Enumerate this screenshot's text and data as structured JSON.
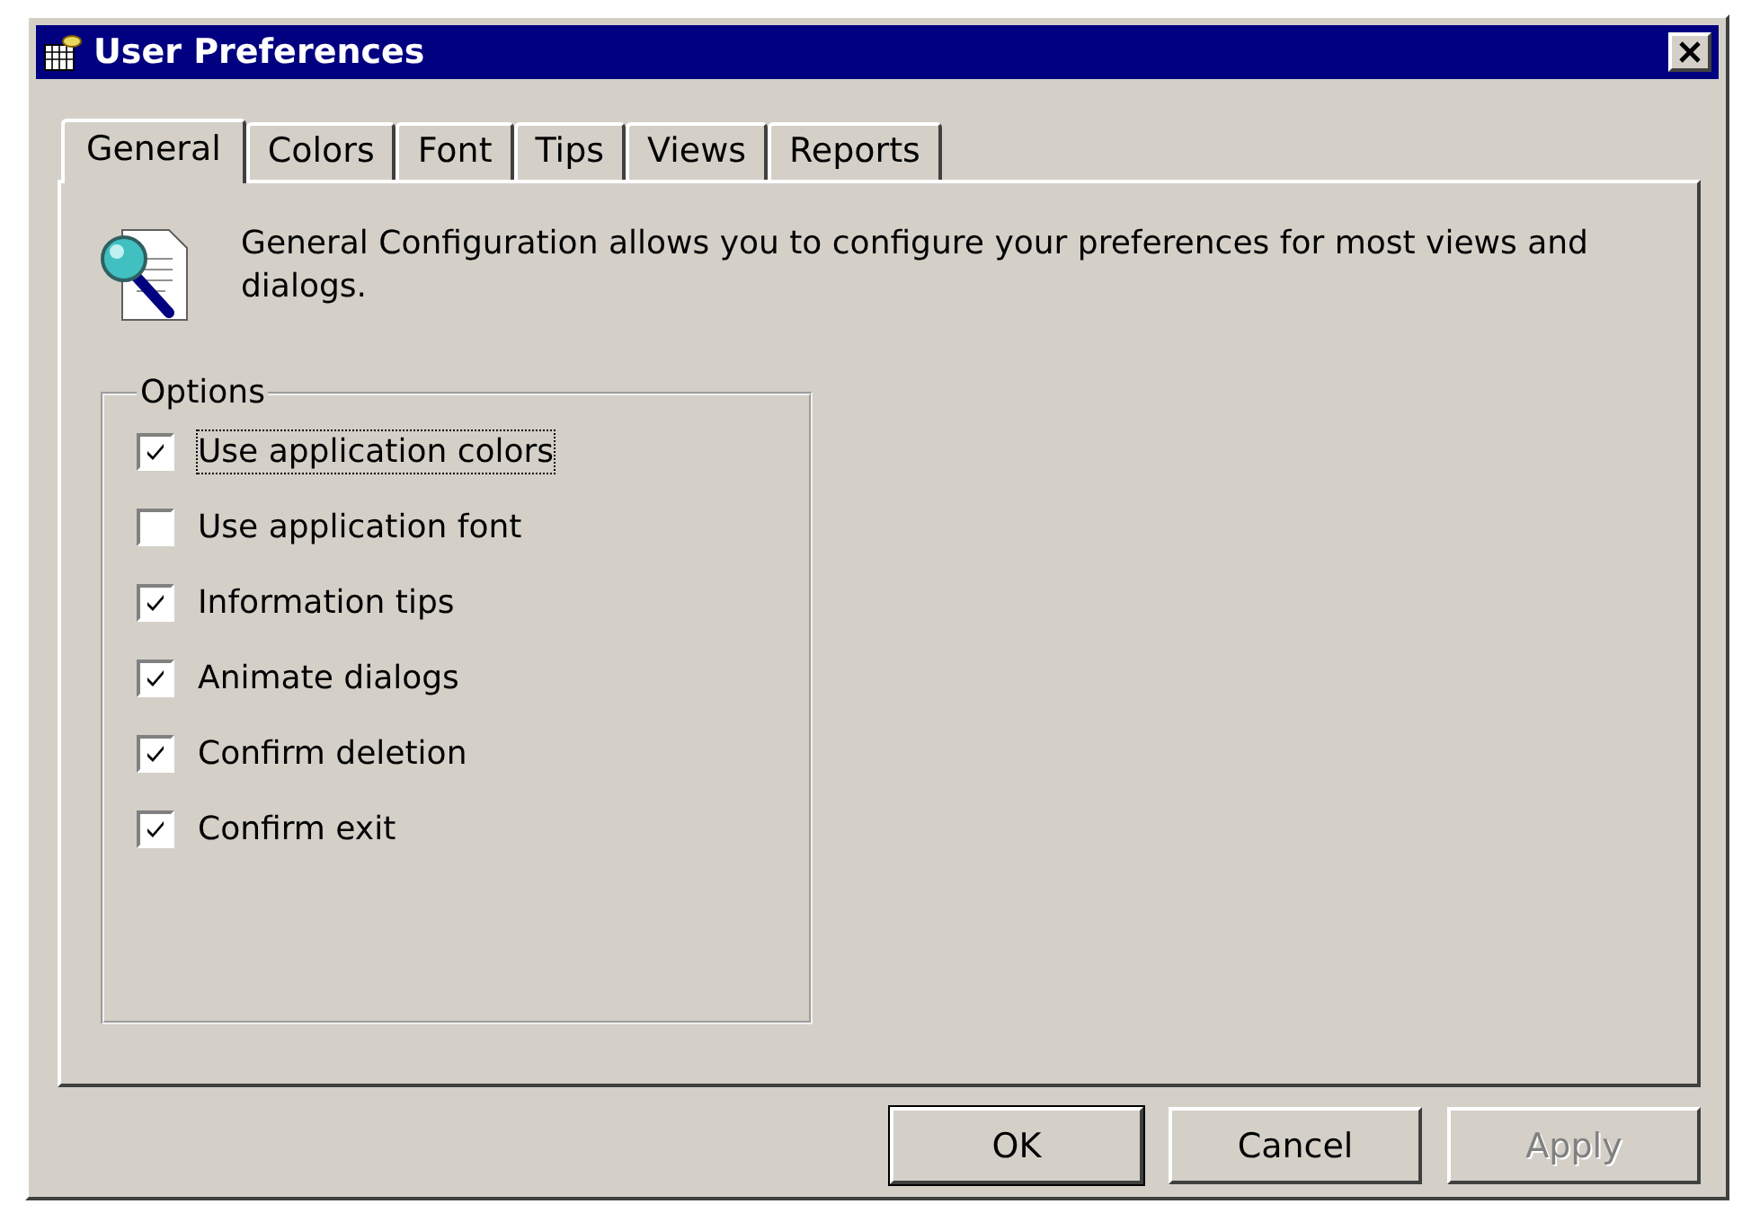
{
  "window": {
    "title": "User Preferences"
  },
  "tabs": [
    {
      "label": "General",
      "selected": true
    },
    {
      "label": "Colors",
      "selected": false
    },
    {
      "label": "Font",
      "selected": false
    },
    {
      "label": "Tips",
      "selected": false
    },
    {
      "label": "Views",
      "selected": false
    },
    {
      "label": "Reports",
      "selected": false
    }
  ],
  "description": "General Configuration allows you to configure your preferences for most views and dialogs.",
  "options": {
    "title": "Options",
    "items": [
      {
        "label": "Use application colors",
        "checked": true,
        "focused": true
      },
      {
        "label": "Use application font",
        "checked": false,
        "focused": false
      },
      {
        "label": "Information tips",
        "checked": true,
        "focused": false
      },
      {
        "label": "Animate dialogs",
        "checked": true,
        "focused": false
      },
      {
        "label": "Confirm deletion",
        "checked": true,
        "focused": false
      },
      {
        "label": "Confirm exit",
        "checked": true,
        "focused": false
      }
    ]
  },
  "buttons": [
    {
      "label": "OK",
      "default": true,
      "disabled": false
    },
    {
      "label": "Cancel",
      "default": false,
      "disabled": false
    },
    {
      "label": "Apply",
      "default": false,
      "disabled": true
    }
  ]
}
